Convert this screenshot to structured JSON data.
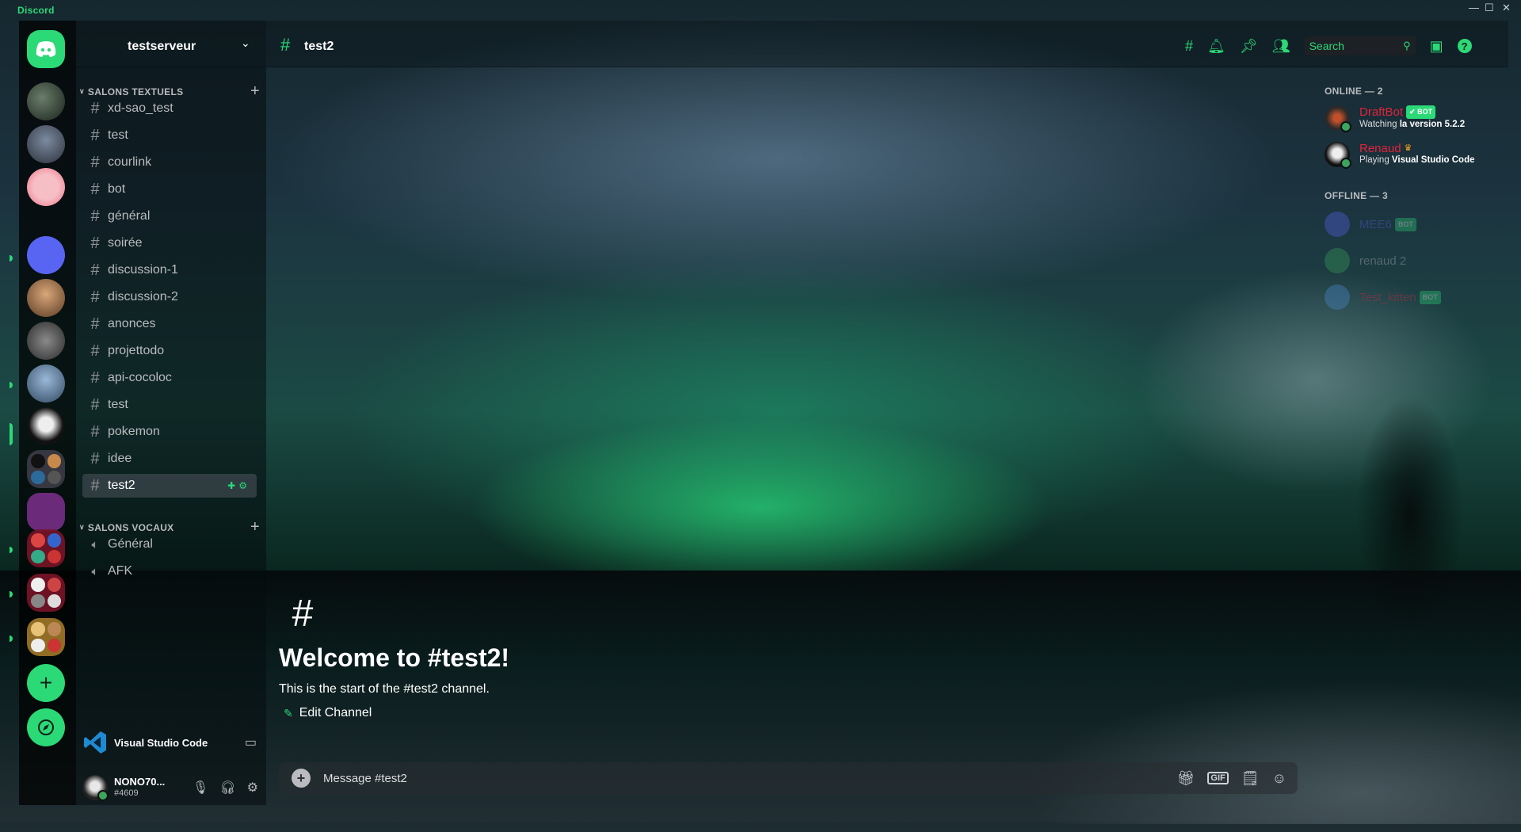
{
  "app": {
    "title": "Discord"
  },
  "server": {
    "name": "testserveur",
    "text_category": "SALONS TEXTUELS",
    "voice_category": "SALONS VOCAUX",
    "text_channels": [
      "xd-sao_test",
      "test",
      "courlink",
      "bot",
      "général",
      "soirée",
      "discussion-1",
      "discussion-2",
      "anonces",
      "projettodo",
      "api-cocoloc",
      "test",
      "pokemon",
      "idee",
      "test2"
    ],
    "voice_channels": [
      "Général",
      "AFK"
    ],
    "active_channel": "test2"
  },
  "activity": {
    "label": "Visual Studio Code"
  },
  "user": {
    "name": "NONO70...",
    "tag": "#4609"
  },
  "header": {
    "channel": "test2",
    "search_placeholder": "Search"
  },
  "welcome": {
    "title": "Welcome to #test2!",
    "subtitle": "This is the start of the #test2 channel.",
    "edit_label": "Edit Channel"
  },
  "composer": {
    "placeholder": "Message #test2",
    "gif_label": "GIF"
  },
  "members": {
    "online_header": "ONLINE — 2",
    "offline_header": "OFFLINE — 3",
    "online": [
      {
        "name": "DraftBot",
        "badge": "✔ BOT",
        "status_prefix": "Watching ",
        "status_bold": "la version 5.2.2",
        "name_color": "#e0243b"
      },
      {
        "name": "Renaud",
        "status_prefix": "Playing ",
        "status_bold": "Visual Studio Code",
        "name_color": "#e0243b"
      }
    ],
    "offline": [
      {
        "name": "MEE6",
        "badge": "BOT",
        "name_color": "#5865f2"
      },
      {
        "name": "renaud 2",
        "name_color": "#b9bbbe"
      },
      {
        "name": "Test_kitten",
        "badge": "BOT",
        "name_color": "#e0243b"
      }
    ]
  },
  "colors": {
    "accent": "#2bd977",
    "text": "#dcddde",
    "muted": "#b9bbbe"
  }
}
